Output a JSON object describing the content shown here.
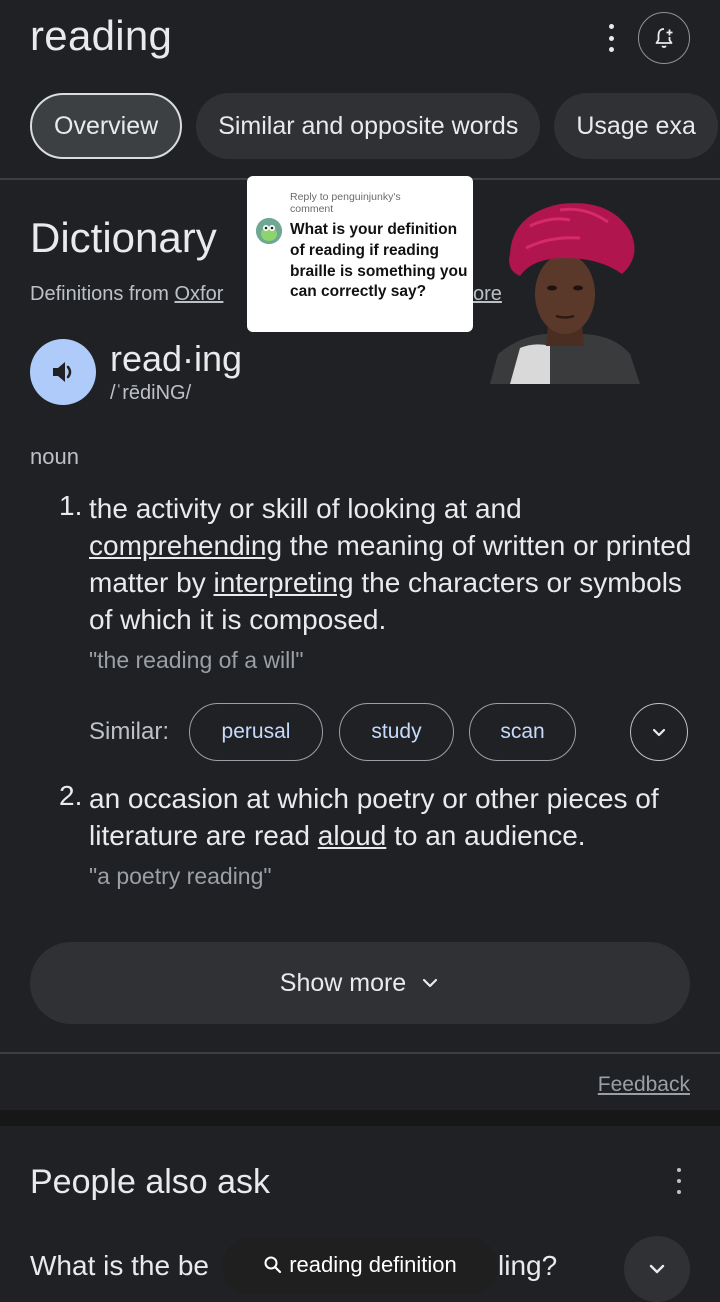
{
  "header": {
    "title": "reading"
  },
  "tabs": [
    {
      "label": "Overview",
      "active": true
    },
    {
      "label": "Similar and opposite words",
      "active": false
    },
    {
      "label": "Usage exa",
      "active": false
    }
  ],
  "dictionary": {
    "title": "Dictionary",
    "source_prefix": "Definitions from ",
    "source_link": "Oxfor",
    "source_more": "ore",
    "word": "read·ing",
    "phonetic": "/ˈrēdiNG/",
    "part_of_speech": "noun",
    "definitions": [
      {
        "number": "1.",
        "parts": [
          "the activity or skill of looking at and ",
          "comprehending",
          " the meaning of written or printed matter by ",
          "interpreting",
          " the characters or symbols of which it is composed."
        ],
        "example": "\"the reading of a will\""
      },
      {
        "number": "2.",
        "parts": [
          "an occasion at which poetry or other pieces of literature are read ",
          "aloud",
          " to an audience."
        ],
        "example": "\"a poetry reading\""
      }
    ],
    "similar_label": "Similar:",
    "similar": [
      "perusal",
      "study",
      "scan"
    ],
    "show_more": "Show more"
  },
  "feedback": "Feedback",
  "people_also_ask": {
    "title": "People also ask",
    "question_start": "What is the be",
    "question_end": "ling?"
  },
  "search_pill": {
    "label": "reading definition"
  },
  "reply_bubble": {
    "header": "Reply to penguinjunky's comment",
    "text": "What is your definition of reading if reading braille is something you can correctly say?"
  },
  "icons": {
    "kebab": "more-vert-icon",
    "alert": "notification-add-icon",
    "speaker": "volume-icon",
    "chevron": "chevron-down-icon",
    "search": "search-icon"
  },
  "colors": {
    "background": "#202124",
    "chip_text": "#c6dafc",
    "speaker_bg": "#aecbfa"
  }
}
